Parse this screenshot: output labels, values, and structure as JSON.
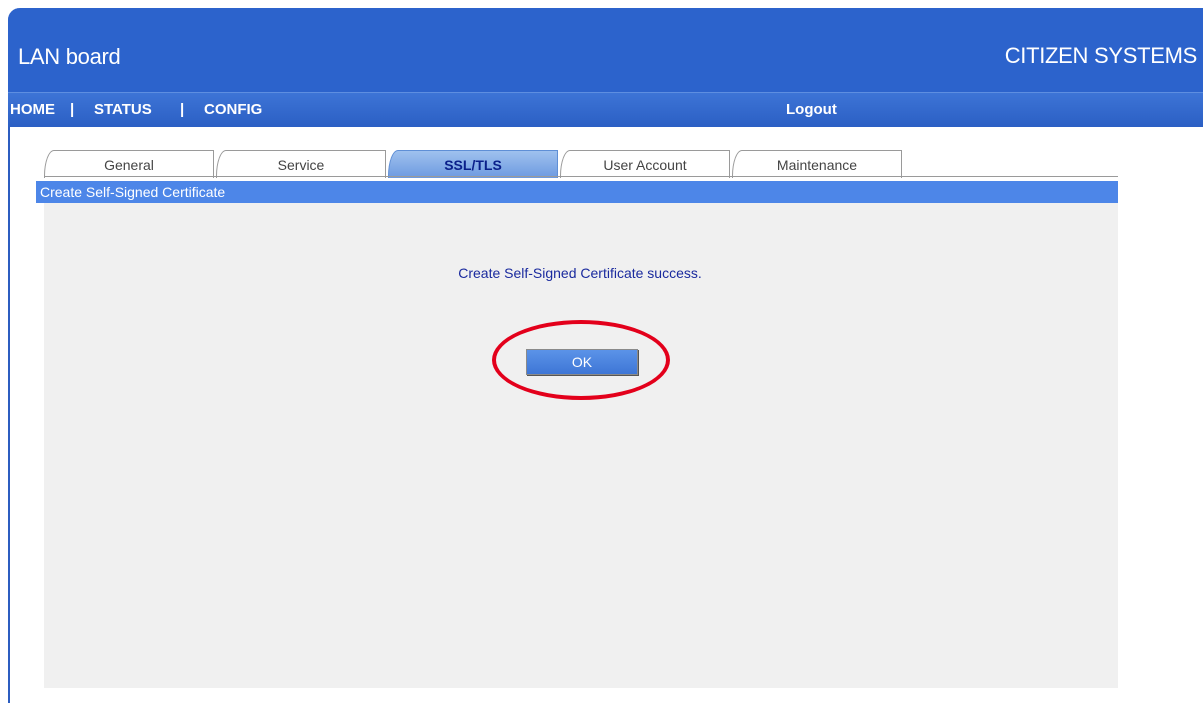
{
  "header": {
    "app_title": "LAN board",
    "brand": "CITIZEN SYSTEMS"
  },
  "nav": {
    "home": "HOME",
    "separator": "|",
    "status": "STATUS",
    "config": "CONFIG",
    "logout": "Logout"
  },
  "tabs": [
    {
      "label": "General",
      "active": false
    },
    {
      "label": "Service",
      "active": false
    },
    {
      "label": "SSL/TLS",
      "active": true
    },
    {
      "label": "User Account",
      "active": false
    },
    {
      "label": "Maintenance",
      "active": false
    }
  ],
  "panel": {
    "title": "Create Self-Signed Certificate",
    "message": "Create Self-Signed Certificate success.",
    "ok_label": "OK"
  },
  "colors": {
    "header_blue": "#2c63cc",
    "panel_header_blue": "#4d86e8",
    "message_text": "#1a2a9e",
    "highlight_red": "#e3001b"
  }
}
